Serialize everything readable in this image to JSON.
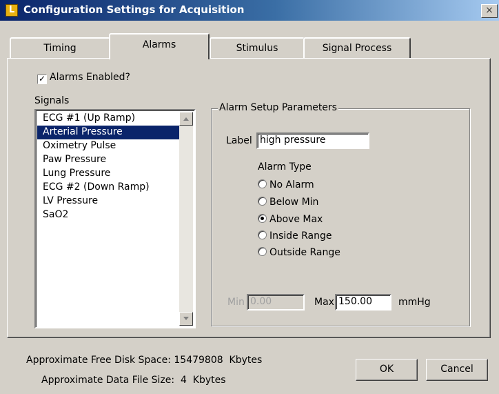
{
  "window": {
    "title": "Configuration Settings for Acquisition",
    "app_icon": "app-icon",
    "close_glyph": "×"
  },
  "tabs": [
    {
      "label": "Timing",
      "active": false
    },
    {
      "label": "Alarms",
      "active": true
    },
    {
      "label": "Stimulus",
      "active": false
    },
    {
      "label": "Signal Process",
      "active": false
    }
  ],
  "alarms_enabled": {
    "label": "Alarms Enabled?",
    "checked": true
  },
  "signals": {
    "label": "Signals",
    "items": [
      "ECG #1 (Up Ramp)",
      "Arterial Pressure",
      "Oximetry Pulse",
      "Paw Pressure",
      "Lung Pressure",
      "ECG #2 (Down Ramp)",
      "LV Pressure",
      "SaO2"
    ],
    "selected": "Arterial Pressure"
  },
  "setup": {
    "group_title": "Alarm Setup Parameters",
    "label_caption": "Label",
    "label_value": "high pressure",
    "alarm_type_caption": "Alarm Type",
    "alarm_types": [
      {
        "label": "No Alarm",
        "selected": false
      },
      {
        "label": "Below Min",
        "selected": false
      },
      {
        "label": "Above Max",
        "selected": true
      },
      {
        "label": "Inside Range",
        "selected": false
      },
      {
        "label": "Outside Range",
        "selected": false
      }
    ],
    "min_caption": "Min",
    "min_value": "0.00",
    "max_caption": "Max",
    "max_value": "150.00",
    "unit": "mmHg"
  },
  "footer": {
    "disk_space": "Approximate Free Disk Space: 15479808  Kbytes",
    "file_size": "Approximate Data File Size:  4  Kbytes",
    "ok_label": "OK",
    "cancel_label": "Cancel"
  },
  "colors": {
    "titlebar_start": "#0a246a",
    "titlebar_end": "#a6caf0",
    "dialog_face": "#d4d0c8",
    "selection": "#0a246a"
  }
}
